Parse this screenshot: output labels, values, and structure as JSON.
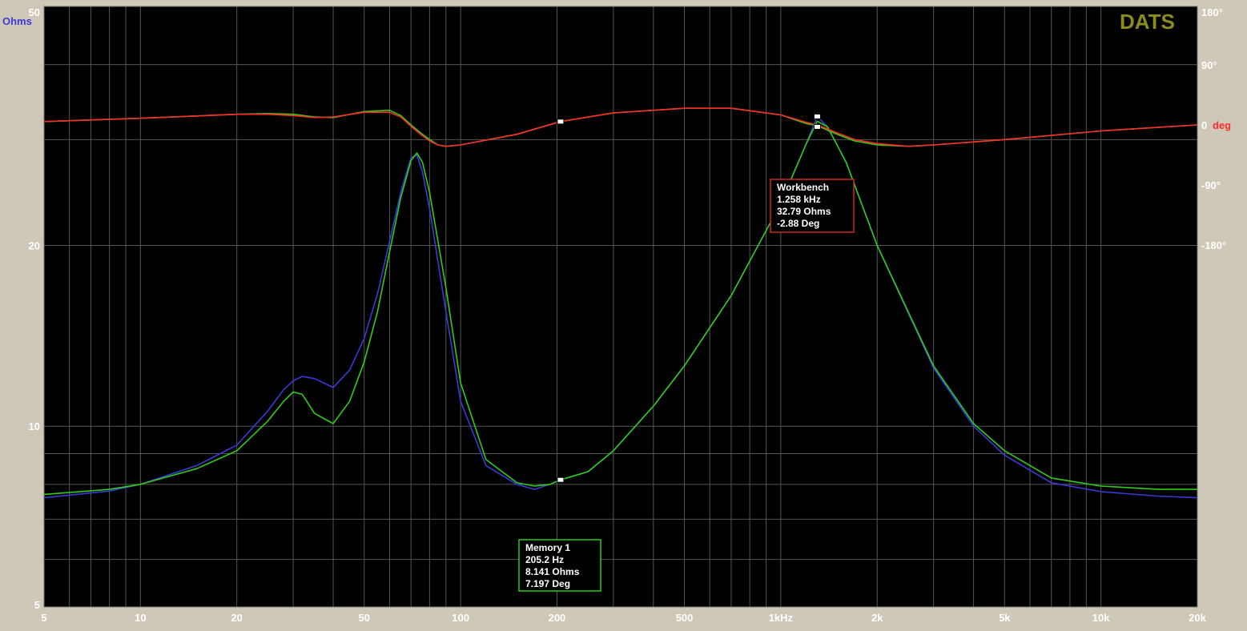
{
  "colors": {
    "background": "#000000",
    "grid": "#555555",
    "impedance": "#3a3ad8",
    "memory": "#2ecc1a",
    "phase": "#ff2a2a",
    "brand": "#8c8c1c",
    "text": "#ffffff"
  },
  "chart_data": {
    "type": "line",
    "title": "DATS",
    "y_unit": "Ohms",
    "y2_unit_value": "0",
    "y2_unit": "deg",
    "x_scale": "log",
    "y_scale": "log",
    "xlim": [
      5,
      20000
    ],
    "ylim": [
      5,
      50
    ],
    "y2lim": [
      -180,
      180
    ],
    "x_ticks": [
      {
        "v": 5,
        "label": "5"
      },
      {
        "v": 10,
        "label": "10"
      },
      {
        "v": 20,
        "label": "20"
      },
      {
        "v": 50,
        "label": "50"
      },
      {
        "v": 100,
        "label": "100"
      },
      {
        "v": 200,
        "label": "200"
      },
      {
        "v": 500,
        "label": "500"
      },
      {
        "v": 1000,
        "label": "1kHz"
      },
      {
        "v": 2000,
        "label": "2k"
      },
      {
        "v": 5000,
        "label": "5k"
      },
      {
        "v": 10000,
        "label": "10k"
      },
      {
        "v": 20000,
        "label": "20k"
      }
    ],
    "y_ticks": [
      {
        "v": 5,
        "label": "5"
      },
      {
        "v": 10,
        "label": "10"
      },
      {
        "v": 20,
        "label": "20"
      },
      {
        "v": 50,
        "label": "50"
      }
    ],
    "y2_ticks": [
      {
        "v": 180,
        "label": "180°"
      },
      {
        "v": 90,
        "label": "90°"
      },
      {
        "v": -90,
        "label": "-90°"
      },
      {
        "v": -180,
        "label": "-180°"
      }
    ],
    "grid": true,
    "series": [
      {
        "axis": "left",
        "color": "#3a3ad8",
        "x": [
          5,
          8,
          10,
          15,
          20,
          25,
          28,
          30,
          32,
          35,
          40,
          45,
          50,
          55,
          60,
          65,
          70,
          73,
          76,
          80,
          90,
          100,
          120,
          150,
          170,
          190,
          205,
          250,
          300,
          400,
          500,
          700,
          1000,
          1200,
          1300,
          1400,
          1600,
          2000,
          3000,
          4000,
          5000,
          7000,
          10000,
          15000,
          20000
        ],
        "y": [
          7.6,
          7.8,
          8.0,
          8.6,
          9.3,
          10.6,
          11.5,
          11.9,
          12.1,
          12.0,
          11.6,
          12.4,
          14.0,
          16.6,
          20.3,
          24.5,
          28.0,
          28.3,
          26.5,
          23.0,
          15.5,
          11.0,
          8.6,
          8.0,
          7.85,
          8.0,
          8.14,
          8.4,
          9.1,
          10.8,
          12.6,
          16.5,
          23.5,
          29.5,
          32.8,
          31.5,
          27.5,
          20.0,
          12.5,
          10.0,
          8.95,
          8.05,
          7.78,
          7.65,
          7.6
        ]
      },
      {
        "axis": "left",
        "color": "#2ecc1a",
        "x": [
          5,
          8,
          10,
          15,
          20,
          25,
          28,
          30,
          32,
          35,
          40,
          45,
          50,
          55,
          60,
          65,
          70,
          73,
          76,
          80,
          90,
          100,
          120,
          150,
          170,
          190,
          205,
          250,
          300,
          400,
          500,
          700,
          1000,
          1200,
          1300,
          1400,
          1600,
          2000,
          3000,
          4000,
          5000,
          7000,
          10000,
          15000,
          20000
        ],
        "y": [
          7.7,
          7.85,
          8.0,
          8.5,
          9.1,
          10.2,
          11.0,
          11.4,
          11.3,
          10.5,
          10.1,
          11.0,
          12.8,
          15.5,
          19.5,
          24.0,
          27.7,
          28.5,
          27.5,
          24.5,
          17.0,
          11.8,
          8.8,
          8.05,
          7.95,
          8.0,
          8.14,
          8.4,
          9.1,
          10.8,
          12.6,
          16.5,
          23.5,
          29.5,
          32.2,
          31.5,
          27.5,
          20.0,
          12.6,
          10.1,
          9.1,
          8.2,
          7.95,
          7.85,
          7.85
        ]
      },
      {
        "axis": "right",
        "color": "#2ecc1a",
        "x": [
          5,
          10,
          20,
          25,
          30,
          35,
          40,
          50,
          60,
          65,
          70,
          75,
          80,
          85,
          90,
          100,
          150,
          205,
          300,
          500,
          700,
          1000,
          1200,
          1300,
          1400,
          1500,
          1700,
          2000,
          2500,
          3000,
          5000,
          10000,
          20000
        ],
        "y": [
          5,
          10,
          16,
          17,
          16,
          12,
          11,
          20,
          22,
          14,
          0,
          -12,
          -22,
          -30,
          -32,
          -30,
          -14,
          5,
          18,
          25,
          25,
          15,
          2,
          -1,
          -8,
          -14,
          -24,
          -30,
          -32,
          -30,
          -22,
          -9,
          0
        ]
      },
      {
        "axis": "right",
        "color": "#ff2a2a",
        "x": [
          5,
          10,
          20,
          25,
          30,
          35,
          40,
          50,
          60,
          65,
          70,
          75,
          80,
          85,
          90,
          100,
          150,
          205,
          300,
          500,
          700,
          1000,
          1200,
          1300,
          1400,
          1500,
          1700,
          2000,
          2500,
          3000,
          5000,
          10000,
          20000
        ],
        "y": [
          5,
          10,
          16,
          16,
          14,
          11,
          12,
          19,
          19,
          12,
          -2,
          -14,
          -24,
          -30,
          -32,
          -30,
          -14,
          5,
          18,
          25,
          25,
          15,
          4,
          0,
          -6,
          -12,
          -22,
          -28,
          -32,
          -30,
          -22,
          -9,
          0
        ]
      }
    ],
    "annotations": [
      {
        "axis": "right",
        "lines": [
          "Workbench",
          "1.258 kHz",
          "32.79 Ohms",
          "-2.88 Deg"
        ],
        "border": "#cc2a1a",
        "fill": "#000000"
      },
      {
        "axis": "left",
        "lines": [
          "Memory 1",
          "205.2 Hz",
          "8.141 Ohms",
          "7.197 Deg"
        ],
        "border": "#2ecc1a",
        "fill": "#000000"
      }
    ]
  }
}
